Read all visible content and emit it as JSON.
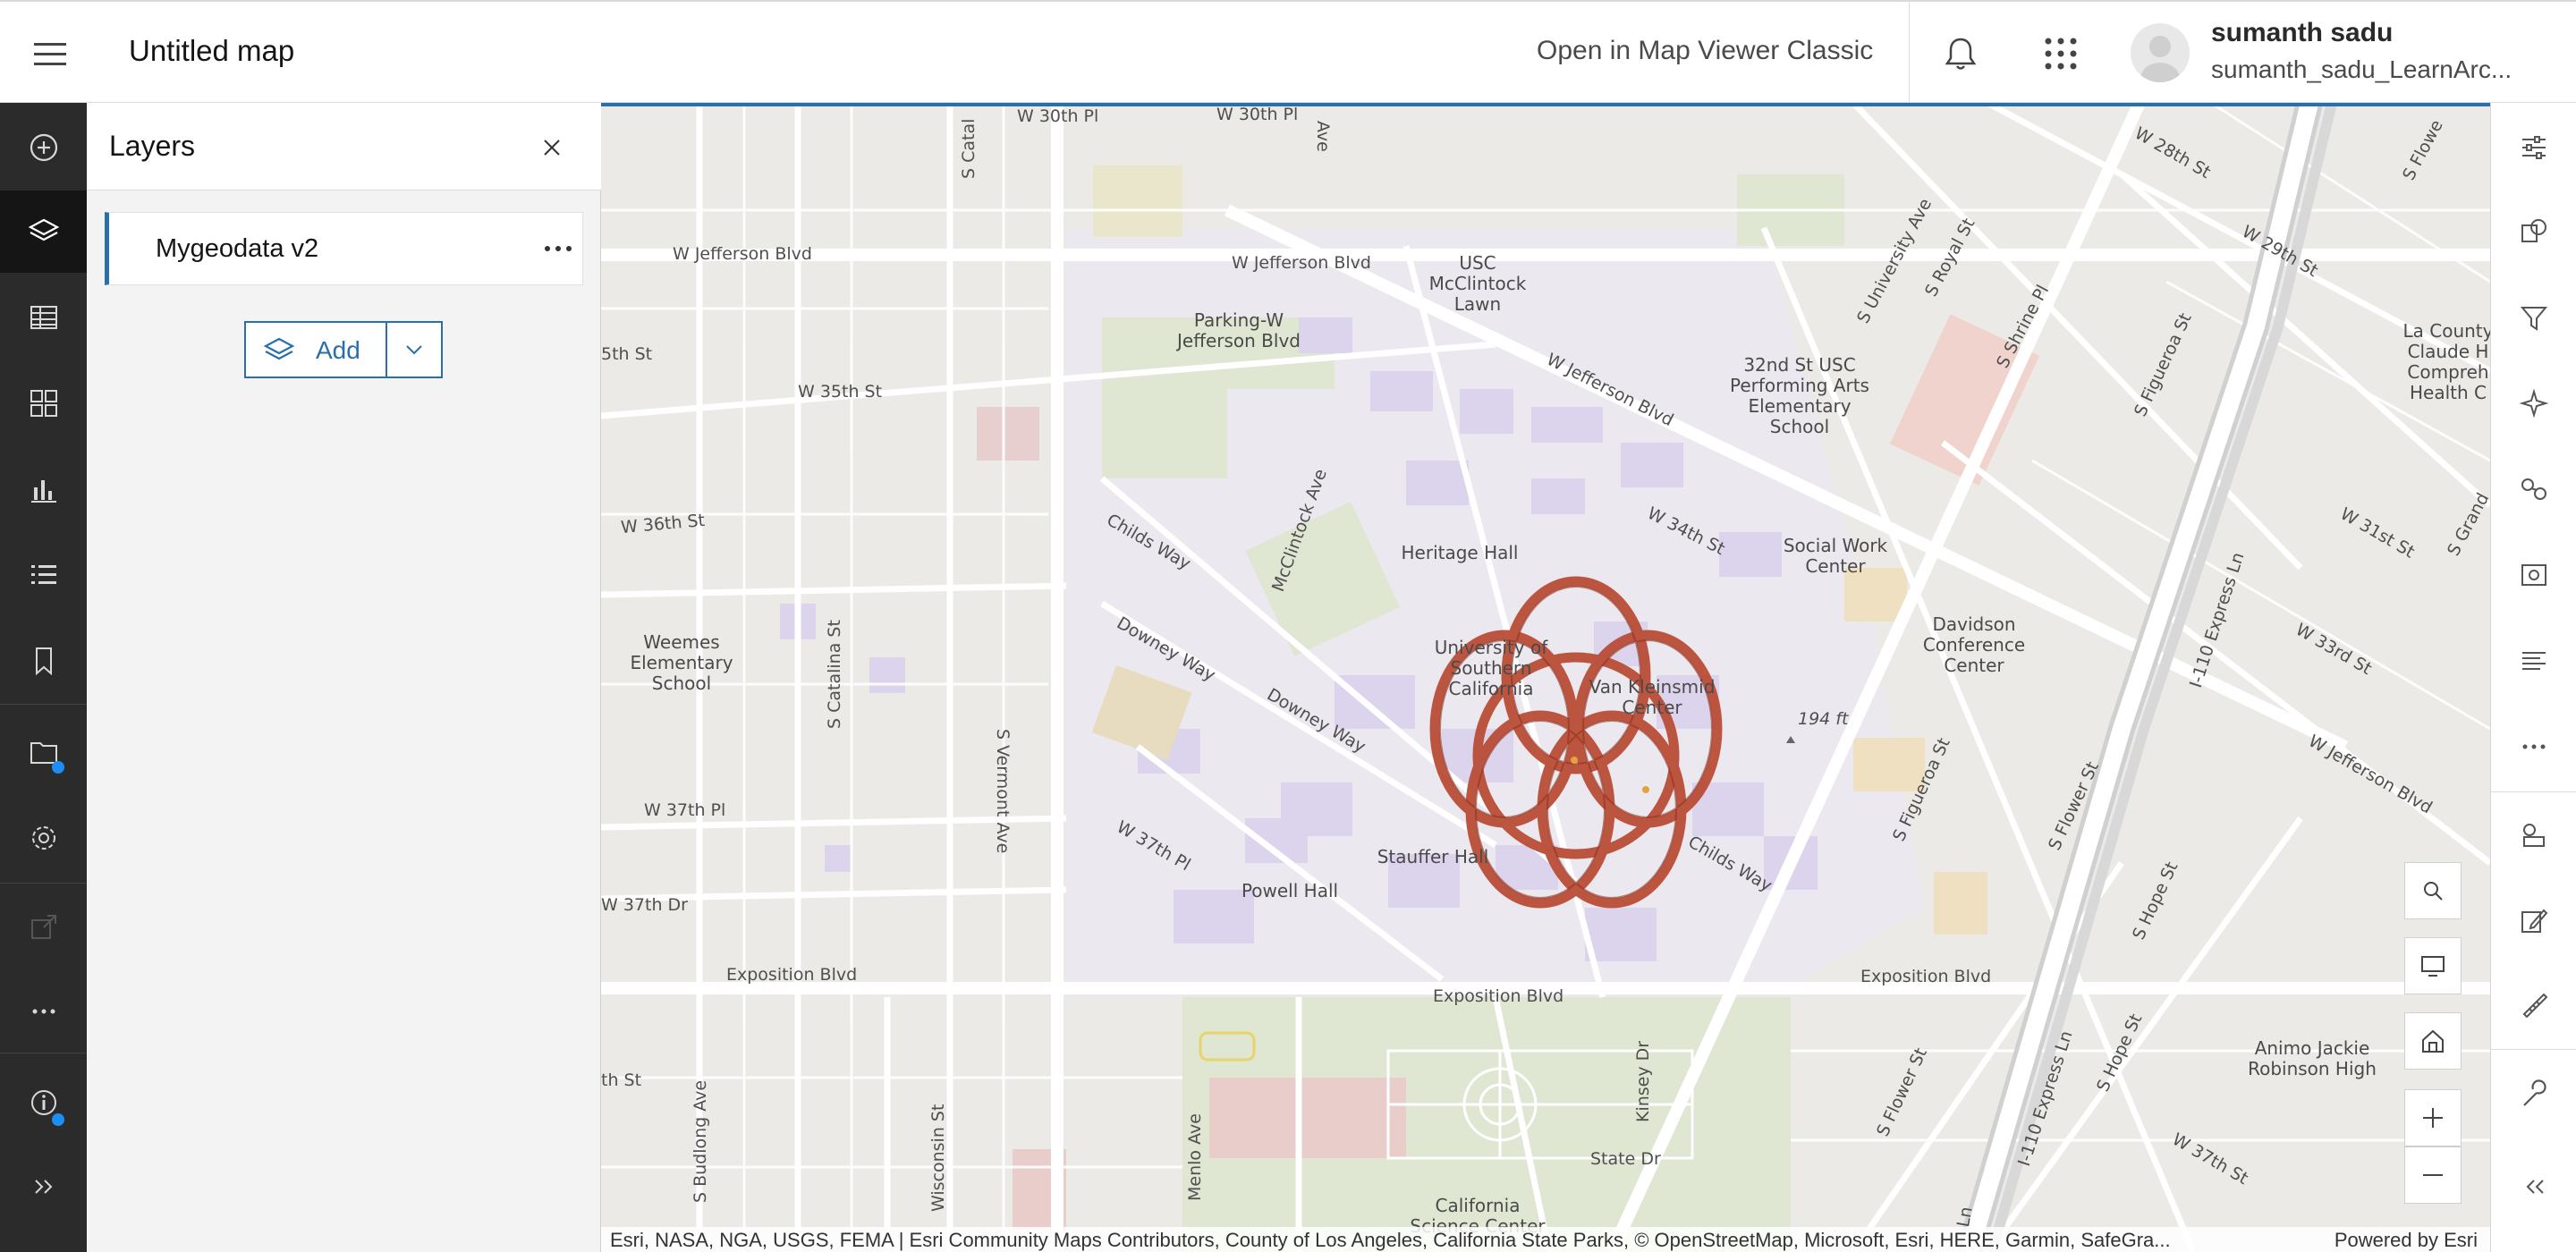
{
  "header": {
    "title": "Untitled map",
    "open_classic": "Open in Map Viewer Classic",
    "user_name": "sumanth sadu",
    "user_id": "sumanth_sadu_LearnArc..."
  },
  "panel": {
    "title": "Layers",
    "layers": [
      {
        "name": "Mygeodata v2"
      }
    ],
    "add_label": "Add"
  },
  "left_bar": [
    "add-icon",
    "layers-icon",
    "table-icon",
    "basemap-icon",
    "charts-icon",
    "legend-icon",
    "bookmarks-icon",
    "map-properties-icon",
    "settings-icon",
    "share-icon",
    "more-icon",
    "info-icon",
    "expand-icon"
  ],
  "right_bar": [
    "properties-icon",
    "styles-icon",
    "filter-icon",
    "effects-icon",
    "pop-ups-icon",
    "configure-icon",
    "labels-icon",
    "more-icon",
    "sketch-icon",
    "edit-icon",
    "measure-icon",
    "tools-icon",
    "collapse-icon"
  ],
  "map": {
    "streets": [
      "W 30th Pl",
      "W 30th Pl",
      "W Jefferson Blvd",
      "W Jefferson Blvd",
      "W Jefferson Blvd",
      "W 35th St",
      "W 36th St",
      "Childs Way",
      "Downey Way",
      "Downey Way",
      "W 37th Pl",
      "W 37th Pl",
      "W 37th Dr",
      "S Vermont Ave",
      "S Catalina St",
      "Exposition Blvd",
      "Exposition Blvd",
      "Exposition Blvd",
      "S Budlong Ave",
      "Wisconsin St",
      "Menlo Ave",
      "Kinsey Dr",
      "State Dr",
      "McClintock Ave",
      "W 34th St",
      "Childs Way",
      "S Figueroa St",
      "S Figueroa St",
      "S Flower St",
      "S Flower St",
      "S Hope St",
      "S Hope St",
      "I-110 Express Ln",
      "I-110 Express Ln",
      "W 28th St",
      "W 29th St",
      "W 31st St",
      "W 33rd St",
      "W 37th St",
      "S University Ave",
      "S Royal St",
      "S Shrine Pl",
      "W Jefferson Blvd",
      "S Grand",
      "Ln",
      "5th St",
      "th St",
      "Ave",
      "S Catal",
      "S Flowe"
    ],
    "pois": [
      "USC McClintock Lawn",
      "Parking-W Jefferson Blvd",
      "32nd St USC Performing Arts Elementary School",
      "Heritage Hall",
      "Social Work Center",
      "Davidson Conference Center",
      "University of Southern California",
      "Van Kleinsmid Center",
      "Weemes Elementary School",
      "Stauffer Hall",
      "Powell Hall",
      "Animo Jackie Robinson High",
      "California Science Center",
      "La County Claude H Compreh Health C"
    ],
    "elevation": "194 ft"
  },
  "attribution": {
    "text": "Esri, NASA, NGA, USGS, FEMA | Esri Community Maps Contributors, County of Los Angeles, California State Parks, © OpenStreetMap, Microsoft, Esri, HERE, Garmin, SafeGra...",
    "powered": "Powered by Esri"
  },
  "colors": {
    "accent": "#2a6fad",
    "ring": "#b84a32",
    "actionbar": "#2b2b2b"
  }
}
